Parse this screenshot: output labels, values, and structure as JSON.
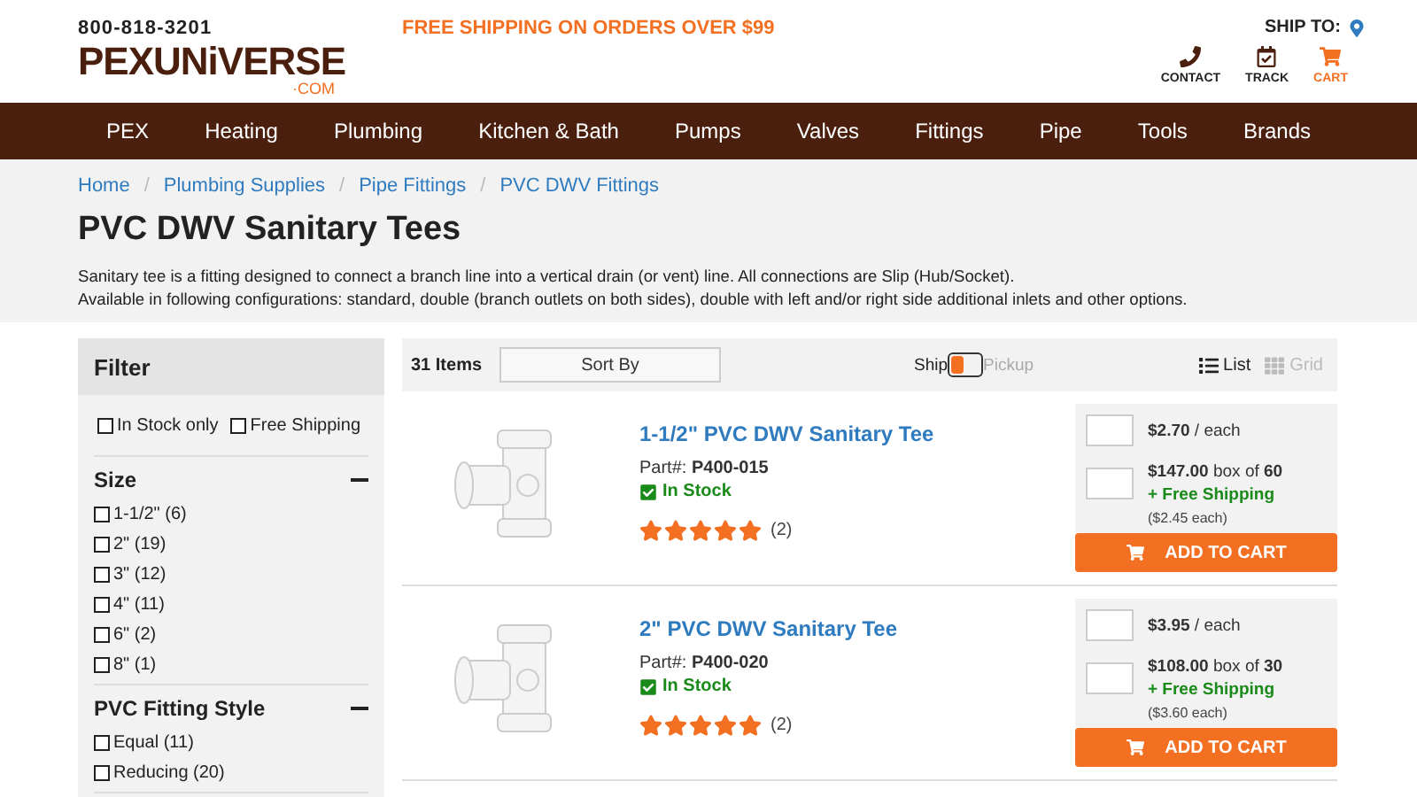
{
  "header": {
    "phone": "800-818-3201",
    "logo": "PEXUNiVERSE",
    "logo_suffix": "·COM",
    "promo": "FREE SHIPPING ON ORDERS OVER $99",
    "ship_to": "SHIP TO:",
    "actions": [
      {
        "kind": "phone",
        "label": "CONTACT",
        "selected": false
      },
      {
        "kind": "track",
        "label": "TRACK",
        "selected": false
      },
      {
        "kind": "cart",
        "label": "CART",
        "selected": true
      }
    ]
  },
  "nav": [
    "PEX",
    "Heating",
    "Plumbing",
    "Kitchen & Bath",
    "Pumps",
    "Valves",
    "Fittings",
    "Pipe",
    "Tools",
    "Brands"
  ],
  "breadcrumb_separator": "/",
  "breadcrumbs": [
    "Home",
    "Plumbing Supplies",
    "Pipe Fittings",
    "PVC DWV Fittings"
  ],
  "page_title": "PVC DWV Sanitary Tees",
  "description": [
    "Sanitary tee is a fitting designed to connect a branch line into a vertical drain (or vent) line. All connections are Slip (Hub/Socket).",
    "Available in following configurations: standard, double (branch outlets on both sides), double with left and/or right side additional inlets and other options."
  ],
  "filter": {
    "title": "Filter",
    "quick": [
      {
        "label": "In Stock only",
        "checked": false
      },
      {
        "label": "Free Shipping",
        "checked": false
      }
    ],
    "sections": [
      {
        "title": "Size",
        "expanded": true,
        "options": [
          {
            "label": "1-1/2\" (6)",
            "checked": false
          },
          {
            "label": "2\" (19)",
            "checked": false
          },
          {
            "label": "3\" (12)",
            "checked": false
          },
          {
            "label": "4\" (11)",
            "checked": false
          },
          {
            "label": "6\" (2)",
            "checked": false
          },
          {
            "label": "8\" (1)",
            "checked": false
          }
        ]
      },
      {
        "title": "PVC Fitting Style",
        "expanded": true,
        "options": [
          {
            "label": "Equal (11)",
            "checked": false
          },
          {
            "label": "Reducing (20)",
            "checked": false
          }
        ]
      }
    ]
  },
  "toolbar": {
    "count": "31 Items",
    "sort": "Sort By",
    "fulfillment": [
      {
        "label": "Ship",
        "selected": true
      },
      {
        "label": "Pickup",
        "selected": false
      }
    ],
    "views": [
      {
        "kind": "list",
        "label": "List",
        "selected": true
      },
      {
        "kind": "grid",
        "label": "Grid",
        "selected": false
      }
    ]
  },
  "products": [
    {
      "name": "1-1/2\" PVC DWV Sanitary Tee",
      "part": "Part#: **P400-015**",
      "stock": "In Stock",
      "in_stock": true,
      "stars": 5,
      "reviews": "(2)",
      "unit_price": "**$2.70** / each",
      "box_price": "**$147.00** box of **60**",
      "free_shipping": "+ Free Shipping",
      "box_each": "($2.45 each)",
      "button": "ADD TO CART"
    },
    {
      "name": "2\" PVC DWV Sanitary Tee",
      "part": "Part#: **P400-020**",
      "stock": "In Stock",
      "in_stock": true,
      "stars": 5,
      "reviews": "(2)",
      "unit_price": "**$3.95** / each",
      "box_price": "**$108.00** box of **30**",
      "free_shipping": "+ Free Shipping",
      "box_each": "($3.60 each)",
      "button": "ADD TO CART"
    }
  ]
}
